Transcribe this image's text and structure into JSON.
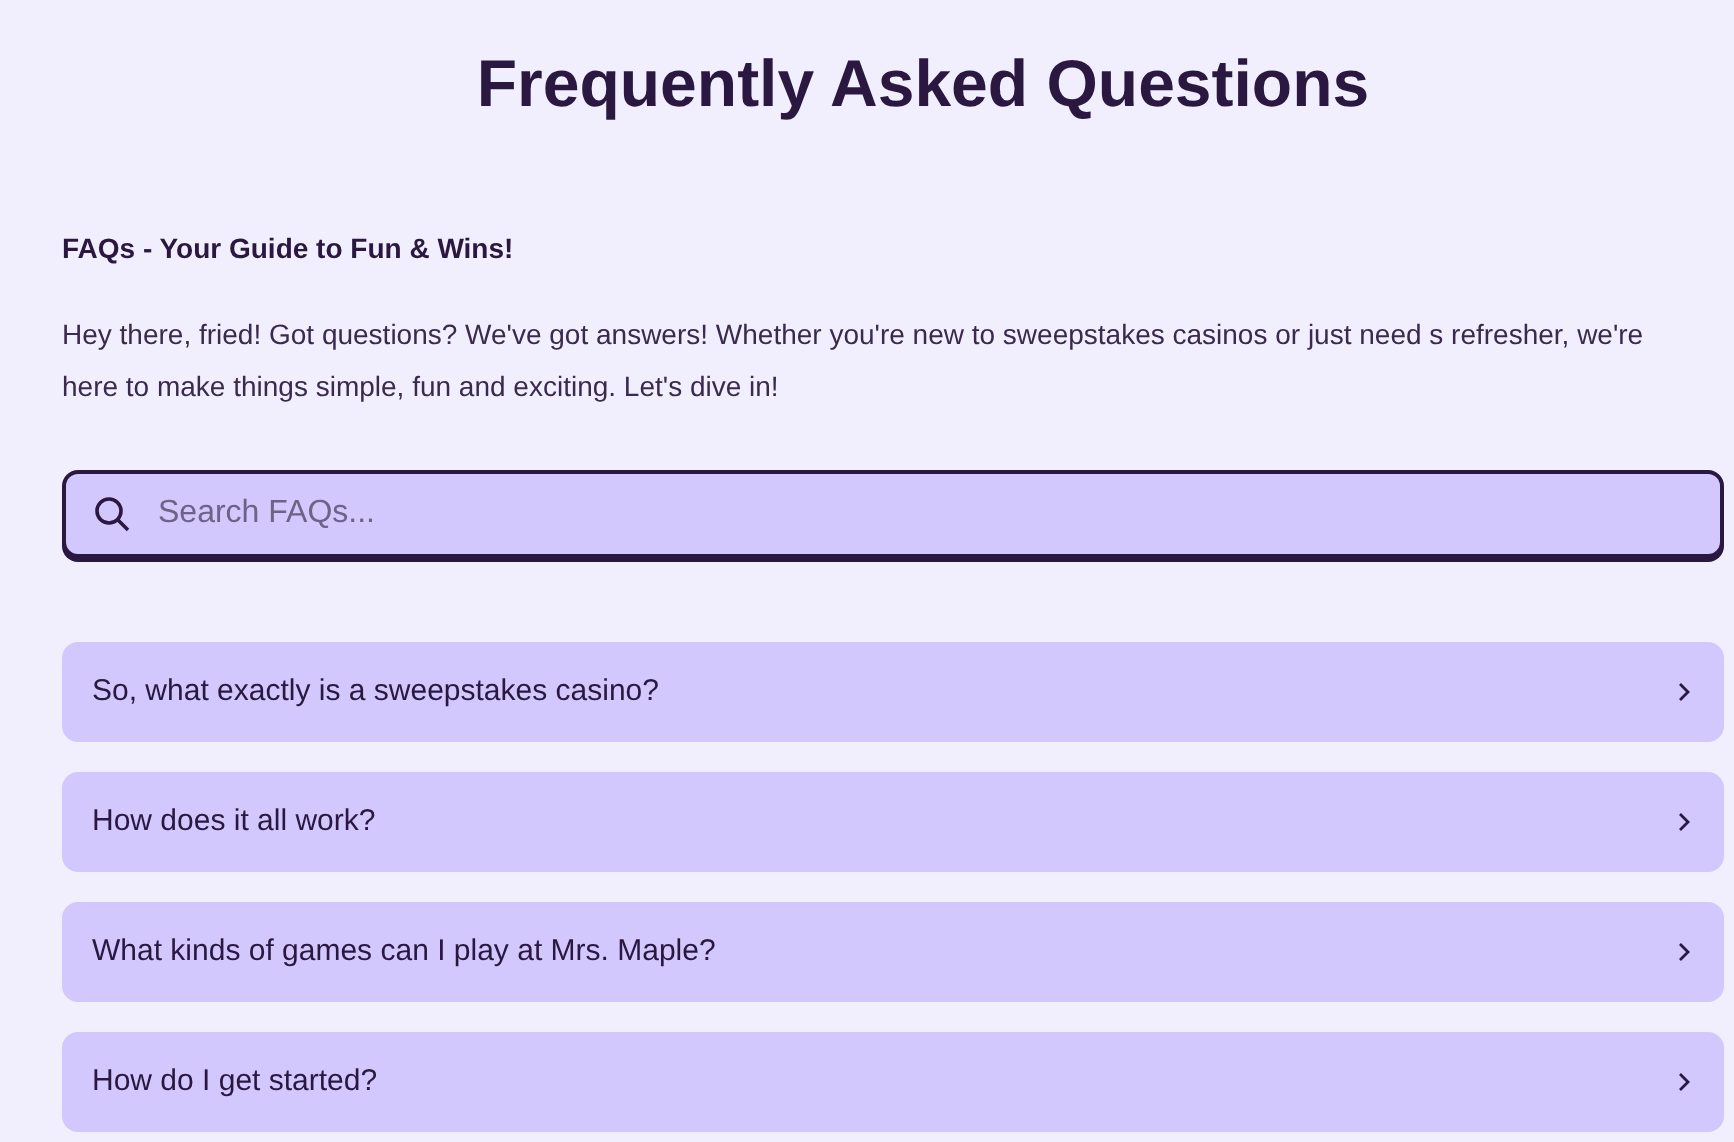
{
  "title": "Frequently Asked Questions",
  "subtitle": "FAQs - Your Guide to Fun & Wins!",
  "intro": "Hey there, fried! Got questions? We've got answers! Whether you're new to sweepstakes casinos or just need s refresher, we're here to make things simple, fun and exciting. Let's dive in!",
  "search": {
    "placeholder": "Search FAQs..."
  },
  "faqs": [
    {
      "question": "So, what exactly is a sweepstakes casino?",
      "expanded": false
    },
    {
      "question": "How does it all work?",
      "expanded": false
    },
    {
      "question": "What kinds of games can I play at Mrs. Maple?",
      "expanded": false
    },
    {
      "question": "How do I get started?",
      "expanded": false
    }
  ]
}
